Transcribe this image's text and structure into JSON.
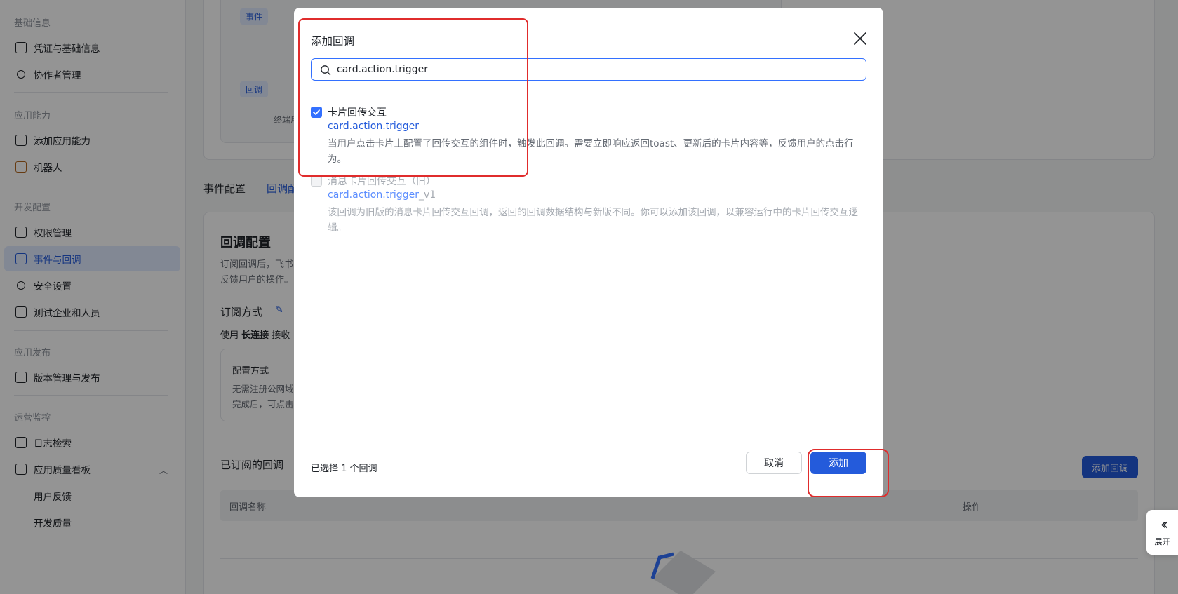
{
  "sidebar": {
    "groups": [
      "基础信息",
      "应用能力",
      "开发配置",
      "应用发布",
      "运营监控"
    ],
    "items": [
      {
        "label": "凭证与基础信息"
      },
      {
        "label": "协作者管理"
      },
      {
        "label": "添加应用能力"
      },
      {
        "label": "机器人"
      },
      {
        "label": "权限管理"
      },
      {
        "label": "事件与回调"
      },
      {
        "label": "安全设置"
      },
      {
        "label": "测试企业和人员"
      },
      {
        "label": "版本管理与发布"
      },
      {
        "label": "日志检索"
      },
      {
        "label": "应用质量看板"
      },
      {
        "label": "用户反馈"
      },
      {
        "label": "开发质量"
      }
    ]
  },
  "background": {
    "tag_event": "事件",
    "tag_callback": "回调",
    "terminal_label": "终端用",
    "tab_events": "事件配置",
    "tab_callbacks": "回调配",
    "section_title": "回调配置",
    "section_desc_1": "订阅回调后，飞书",
    "section_desc_2": "反馈用户的操作。",
    "subscribe_label": "订阅方式",
    "subscribe_prefix": "使用",
    "subscribe_mode": "长连接",
    "subscribe_suffix": "接收",
    "config_title": "配置方式",
    "config_desc_1": "无需注册公网域",
    "config_desc_2": "完成后，可点击",
    "subscribed_title": "已订阅的回调",
    "add_callback_button": "添加回调",
    "table_col_name": "回调名称",
    "table_col_action": "操作"
  },
  "expand_label": "展开",
  "modal": {
    "title": "添加回调",
    "search_value": "card.action.trigger",
    "options": [
      {
        "checked": true,
        "name": "卡片回传交互",
        "key": "card.action.trigger",
        "desc": "当用户点击卡片上配置了回传交互的组件时，触发此回调。需要立即响应返回toast、更新后的卡片内容等，反馈用户的点击行为。"
      },
      {
        "checked": false,
        "name": "消息卡片回传交互（旧）",
        "key": "card.action.trigger",
        "key_suffix": "_v1",
        "desc": "该回调为旧版的消息卡片回传交互回调，返回的回调数据结构与新版不同。你可以添加该回调，以兼容运行中的卡片回传交互逻辑。"
      }
    ],
    "selected_count": "已选择 1 个回调",
    "cancel_label": "取消",
    "add_label": "添加"
  },
  "colors": {
    "accent": "#245bdb",
    "checkbox": "#3370ff",
    "annotation": "#e02c2c"
  }
}
